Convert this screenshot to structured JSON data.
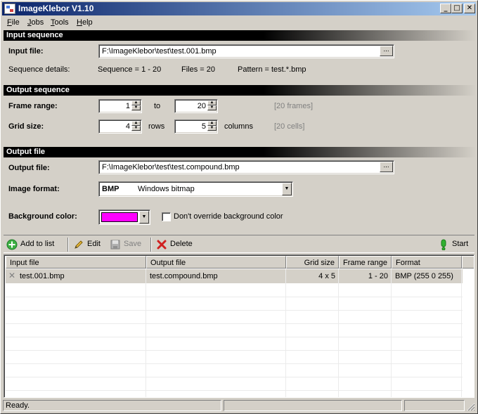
{
  "window": {
    "title": "ImageKlebor V1.10"
  },
  "menu": [
    {
      "first": "F",
      "rest": "ile"
    },
    {
      "first": "J",
      "rest": "obs"
    },
    {
      "first": "T",
      "rest": "ools"
    },
    {
      "first": "H",
      "rest": "elp"
    }
  ],
  "input_sequence": {
    "section_title": "Input sequence",
    "input_file_label": "Input file:",
    "input_file_value": "F:\\ImageKlebor\\test\\test.001.bmp",
    "browse_label": "...",
    "details_label": "Sequence details:",
    "sequence": "Sequence = 1 - 20",
    "files": "Files = 20",
    "pattern": "Pattern = test.*.bmp"
  },
  "output_sequence": {
    "section_title": "Output sequence",
    "frame_range_label": "Frame range:",
    "frame_from": "1",
    "to_label": "to",
    "frame_to": "20",
    "frames_info": "[20 frames]",
    "grid_size_label": "Grid size:",
    "rows_value": "4",
    "rows_label": "rows",
    "columns_value": "5",
    "columns_label": "columns",
    "cells_info": "[20 cells]"
  },
  "output_file": {
    "section_title": "Output file",
    "output_file_label": "Output file:",
    "output_file_value": "F:\\ImageKlebor\\test\\test.compound.bmp",
    "browse_label": "...",
    "image_format_label": "Image format:",
    "format_code": "BMP",
    "format_name": "Windows bitmap",
    "background_label": "Background color:",
    "background_color": "#ff00ff",
    "override_label": "Don't override background color",
    "override_checked": false
  },
  "toolbar": {
    "add": "Add to list",
    "edit": "Edit",
    "save": "Save",
    "delete": "Delete",
    "start": "Start"
  },
  "table": {
    "columns": [
      "Input file",
      "Output file",
      "Grid size",
      "Frame range",
      "Format"
    ],
    "rows": [
      {
        "input": "test.001.bmp",
        "output": "test.compound.bmp",
        "grid": "4 x 5",
        "range": "1 - 20",
        "format": "BMP (255 0 255)"
      }
    ]
  },
  "status": {
    "text": "Ready."
  },
  "colors": {
    "title_start": "#0a246a",
    "title_end": "#a6caf0",
    "face": "#d4d0c8"
  }
}
